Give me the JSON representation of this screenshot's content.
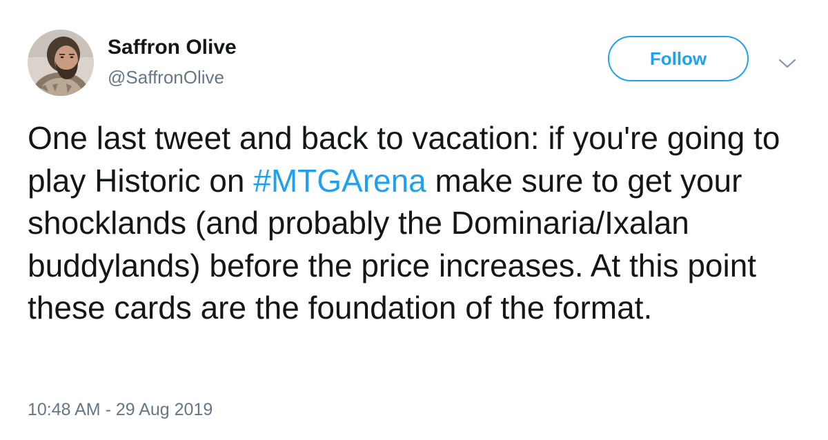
{
  "author": {
    "name": "Saffron Olive",
    "handle": "@SaffronOlive"
  },
  "follow_button": {
    "label": "Follow",
    "color": "#1da1f2"
  },
  "more_menu": {
    "icon": "chevron-down-icon"
  },
  "tweet": {
    "text_before": "One last tweet and back to vacation: if you're going to play Historic on ",
    "hashtag": "#MTGArena",
    "text_after": " make sure to get your shocklands (and probably the Dominaria/Ixalan buddylands) before the price increases. At this point these cards are the foundation of the format.",
    "timestamp": "10:48 AM - 29 Aug 2019"
  },
  "colors": {
    "text": "#14171a",
    "secondary": "#657786",
    "accent": "#1da1f2"
  }
}
